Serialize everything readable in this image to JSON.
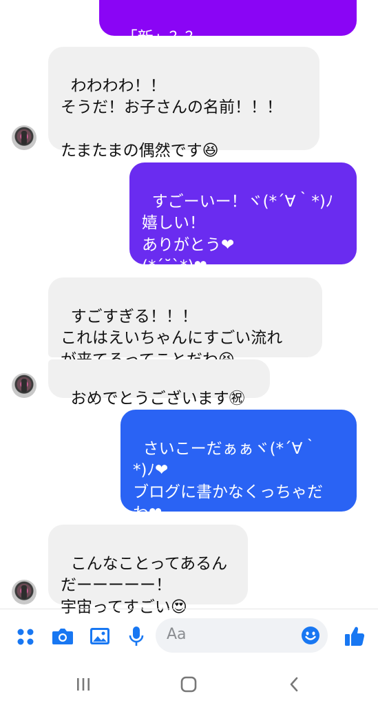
{
  "messages": [
    {
      "id": "m0",
      "direction": "outgoing",
      "text": "「新」？？"
    },
    {
      "id": "m1",
      "direction": "incoming",
      "text": "わわわわ！！\nそうだ！お子さんの名前！！！\n\nたまたまの偶然です😆"
    },
    {
      "id": "m2",
      "direction": "outgoing",
      "text": "すごーいー！ヾ(*´∀｀*)ﾉ\n嬉しい！\nありがとう❤\n(*´˘`*)❤"
    },
    {
      "id": "m3",
      "direction": "incoming",
      "text": "すごすぎる！！！\nこれはえいちゃんにすごい流れ\nが来てるってことだわ😆"
    },
    {
      "id": "m4",
      "direction": "incoming",
      "text": "おめでとうございます㊗"
    },
    {
      "id": "m5",
      "direction": "outgoing",
      "text": "さいこーだぁぁヾ(*´∀｀\n*)ﾉ❤\nブログに書かなくっちゃだ\nわ❤"
    },
    {
      "id": "m6",
      "direction": "incoming",
      "text": "こんなことってあるん\nだーーーーー！\n宇宙ってすごい😍"
    }
  ],
  "composer": {
    "placeholder": "Aa",
    "icons": [
      "apps-icon",
      "camera-icon",
      "gallery-icon",
      "microphone-icon",
      "emoji-icon",
      "thumbs-up-icon"
    ]
  },
  "navbar": {
    "icons": [
      "recent-apps-icon",
      "home-icon",
      "back-icon"
    ]
  },
  "colors": {
    "incoming_bubble": "#f0f0f0",
    "outgoing_purple": "#8a05f5",
    "outgoing_violet": "#6a2cf0",
    "outgoing_blue": "#2a63f4",
    "accent": "#1877f2"
  }
}
